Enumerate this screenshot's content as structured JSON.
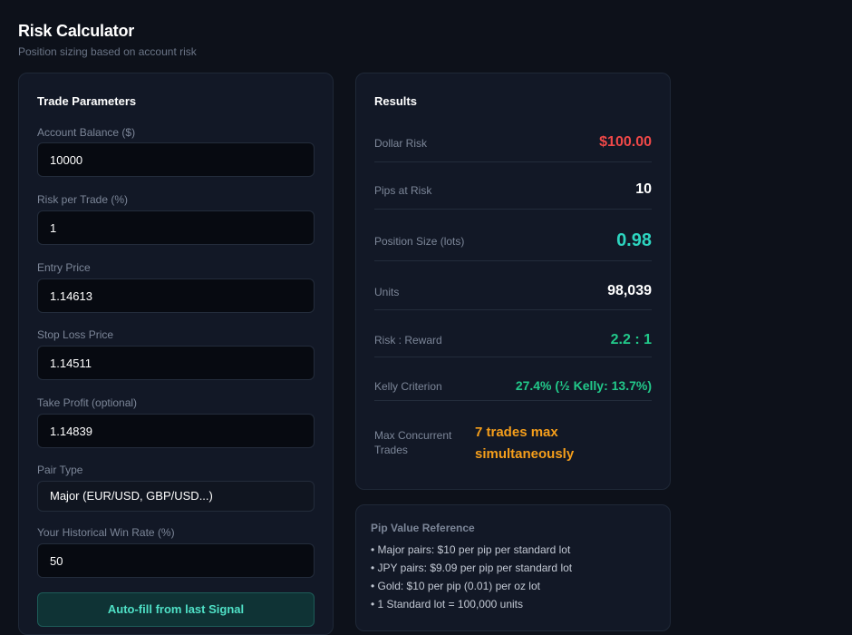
{
  "header": {
    "title": "Risk Calculator",
    "subtitle": "Position sizing based on account risk"
  },
  "params": {
    "title": "Trade Parameters",
    "account_balance": {
      "label": "Account Balance ($)",
      "value": "10000"
    },
    "risk_per_trade": {
      "label": "Risk per Trade (%)",
      "value": "1"
    },
    "entry_price": {
      "label": "Entry Price",
      "value": "1.14613"
    },
    "stop_loss": {
      "label": "Stop Loss Price",
      "value": "1.14511"
    },
    "take_profit": {
      "label": "Take Profit (optional)",
      "value": "1.14839"
    },
    "pair_type": {
      "label": "Pair Type",
      "value": "Major (EUR/USD, GBP/USD...)"
    },
    "win_rate": {
      "label": "Your Historical Win Rate (%)",
      "value": "50"
    },
    "autofill_label": "Auto-fill from last Signal"
  },
  "results": {
    "title": "Results",
    "dollar_risk": {
      "label": "Dollar Risk",
      "value": "$100.00"
    },
    "pips_at_risk": {
      "label": "Pips at Risk",
      "value": "10"
    },
    "position_size": {
      "label": "Position Size (lots)",
      "value": "0.98"
    },
    "units": {
      "label": "Units",
      "value": "98,039"
    },
    "risk_reward": {
      "label": "Risk : Reward",
      "value": "2.2 : 1"
    },
    "kelly": {
      "label": "Kelly Criterion",
      "value": "27.4% (½ Kelly: 13.7%)"
    },
    "max_concurrent": {
      "label_line1": "Max Concurrent",
      "label_line2": "Trades",
      "value_line1": "7 trades max",
      "value_line2": "simultaneously"
    }
  },
  "reference": {
    "title": "Pip Value Reference",
    "lines": [
      "• Major pairs: $10 per pip per standard lot",
      "• JPY pairs: $9.09 per pip per standard lot",
      "• Gold: $10 per pip (0.01) per oz lot",
      "• 1 Standard lot = 100,000 units"
    ]
  },
  "colors": {
    "danger": "#f04848",
    "accent": "#2dd4bf",
    "success": "#22c98a",
    "warning": "#f59e1b"
  }
}
